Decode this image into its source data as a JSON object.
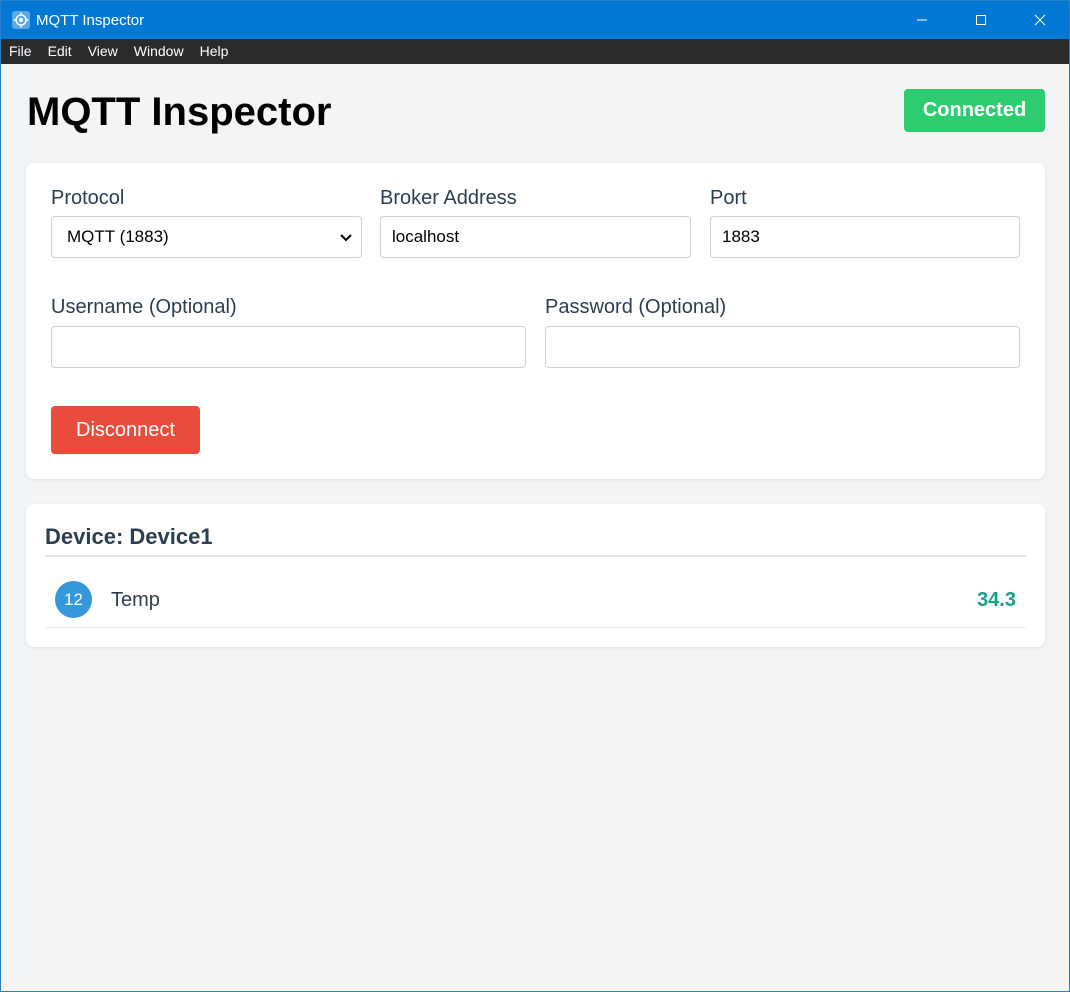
{
  "window": {
    "title": "MQTT Inspector",
    "minimize_icon": "minimize-icon",
    "maximize_icon": "maximize-icon",
    "close_icon": "close-icon"
  },
  "menu": [
    "File",
    "Edit",
    "View",
    "Window",
    "Help"
  ],
  "header": {
    "title": "MQTT Inspector",
    "status": "Connected",
    "status_color": "#2ecc71"
  },
  "connection": {
    "protocol_label": "Protocol",
    "protocol_value": "MQTT (1883)",
    "broker_label": "Broker Address",
    "broker_value": "localhost",
    "port_label": "Port",
    "port_value": "1883",
    "username_label": "Username (Optional)",
    "username_value": "",
    "password_label": "Password (Optional)",
    "password_value": "",
    "disconnect_label": "Disconnect",
    "disconnect_color": "#e74c3c"
  },
  "device": {
    "title": "Device: Device1",
    "metrics": [
      {
        "id": "12",
        "name": "Temp",
        "value": "34.3"
      }
    ]
  }
}
